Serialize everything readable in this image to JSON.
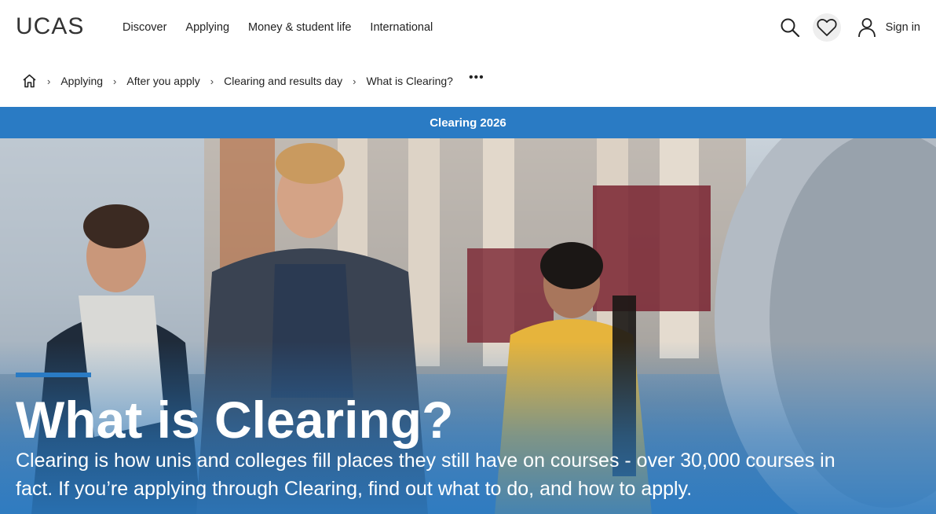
{
  "header": {
    "logo_text": "UCAS",
    "nav": [
      "Discover",
      "Applying",
      "Money & student life",
      "International"
    ],
    "sign_in_label": "Sign in"
  },
  "breadcrumb": {
    "items": [
      "Applying",
      "After you apply",
      "Clearing and results day",
      "What is Clearing?"
    ],
    "more_label": "•••"
  },
  "banner": {
    "text": "Clearing 2026"
  },
  "hero": {
    "title": "What is Clearing?",
    "subtitle": "Clearing is how unis and colleges fill places they still have on courses - over 30,000 courses in fact. If you’re applying through Clearing, find out what to do, and how to apply."
  },
  "colors": {
    "accent": "#2a7bc4",
    "heart_bg": "#eeeeee"
  }
}
